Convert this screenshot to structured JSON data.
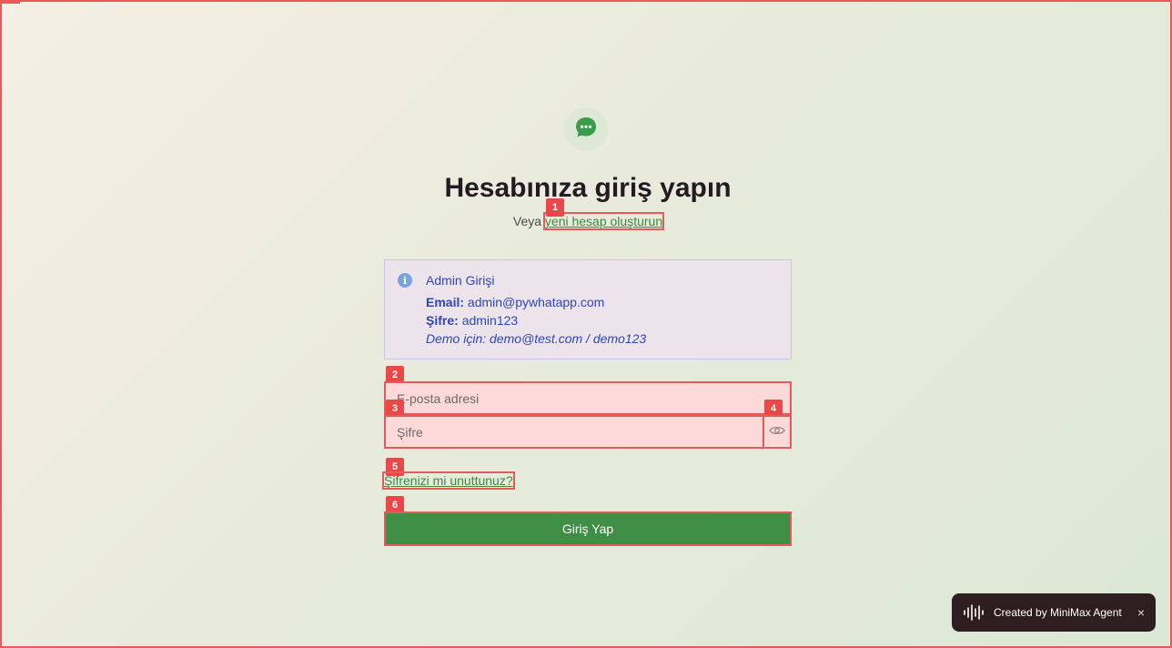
{
  "header": {
    "logo_icon": "chat-bubble-icon",
    "title": "Hesabınıza giriş yapın",
    "subtitle_prefix": "Veya",
    "register_link": "yeni hesap oluşturun"
  },
  "info": {
    "icon": "info-icon",
    "heading": "Admin Girişi",
    "email_label": "Email:",
    "email_value": "admin@pywhatapp.com",
    "password_label": "Şifre:",
    "password_value": "admin123",
    "demo_text": "Demo için: demo@test.com / demo123"
  },
  "form": {
    "email_placeholder": "E-posta adresi",
    "password_placeholder": "Şifre",
    "show_password_icon": "eye-icon",
    "forgot_link": "Şifrenizi mi unuttunuz?",
    "submit_label": "Giriş Yap"
  },
  "badges": [
    "1",
    "2",
    "3",
    "4",
    "5",
    "6"
  ],
  "footer": {
    "brand_icon": "waveform-icon",
    "text": "Created by MiniMax Agent",
    "close": "×"
  },
  "colors": {
    "accent": "#3f8e45",
    "highlight": "#e85a5a",
    "info_text": "#2c48b8"
  }
}
